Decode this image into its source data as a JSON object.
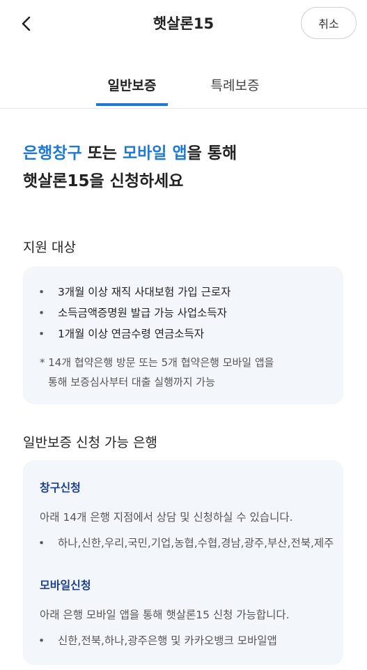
{
  "header": {
    "title": "햇살론15",
    "cancel_label": "취소"
  },
  "tabs": [
    {
      "label": "일반보증",
      "active": true
    },
    {
      "label": "특례보증",
      "active": false
    }
  ],
  "headline": {
    "part1": "은행창구",
    "part2": " 또는 ",
    "part3": "모바일 앱",
    "part4": "을 통해",
    "line2": "햇살론15을 신청하세요"
  },
  "target": {
    "title": "지원 대상",
    "items": [
      "3개월 이상 재직 사대보험 가입 근로자",
      "소득금액증명원 발급 가능 사업소득자",
      "1개월 이상 연금수령 연금소득자"
    ],
    "note_line1": "* 14개 협약은행 방문 또는 5개 협약은행 모바일 앱을",
    "note_line2": "통해 보증심사부터 대출 실행까지 가능"
  },
  "banks": {
    "title": "일반보증 신청 가능 은행",
    "branch": {
      "title": "창구신청",
      "desc": "아래 14개 은행 지점에서 상담 및 신청하실 수 있습니다.",
      "list": "하나,신한,우리,국민,기업,농협,수협,경남,광주,부산,전북,제주"
    },
    "mobile": {
      "title": "모바일신청",
      "desc": "아래 은행 모바일 앱을 통해 햇살론15 신청 가능합니다.",
      "list": "신한,전북,하나,광주은행 및 카카오뱅크 모바일앱"
    }
  },
  "bullet_char": "•",
  "colors": {
    "accent": "#1f7ad1",
    "sub_title": "#1a3f8f",
    "card_bg": "#f3f7fb"
  },
  "icons": {
    "back": "chevron-left-icon"
  }
}
